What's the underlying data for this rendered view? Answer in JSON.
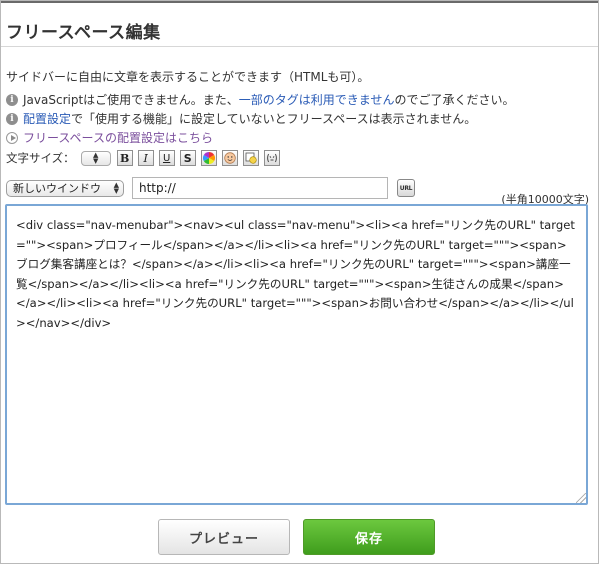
{
  "page": {
    "title": "フリースペース編集",
    "intro": "サイドバーに自由に文章を表示することができます（HTMLも可）。"
  },
  "notices": {
    "js_text_before": "JavaScriptはご使用できません。また、",
    "js_link": "一部のタグは利用できません",
    "js_text_after": "のでご了承ください。",
    "placement_link": "配置設定",
    "placement_text": "で「使用する機能」に設定していないとフリースペースは表示されません。",
    "placement_settings_link": "フリースペースの配置設定はこちら"
  },
  "toolbar": {
    "font_size_label": "文字サイズ：",
    "buttons": [
      {
        "label": "B",
        "name": "bold"
      },
      {
        "label": "I",
        "name": "italic"
      },
      {
        "label": "U",
        "name": "underline"
      },
      {
        "label": "S",
        "name": "strike"
      }
    ]
  },
  "link_row": {
    "target_option": "新しいウインドウ",
    "url_value": "http://",
    "url_button": "URL"
  },
  "editor": {
    "char_limit": "(半角10000文字)",
    "content": "<div class=\"nav-menubar\"><nav><ul class=\"nav-menu\"><li><a href=\"リンク先のURL\" target=\"\"><span>プロフィール</span></a></li><li><a href=\"リンク先のURL\" target=\"\"\"><span>ブログ集客講座とは？</span></a></li><li><a href=\"リンク先のURL\" target=\"\"\"><span>講座一覧</span></a></li><li><a href=\"リンク先のURL\" target=\"\"\"><span>生徒さんの成果</span></a></li><li><a href=\"リンク先のURL\" target=\"\"\"><span>お問い合わせ</span></a></li></ul></nav></div>"
  },
  "actions": {
    "preview": "プレビュー",
    "save": "保存"
  },
  "colors": {
    "link": "#2a5bb6",
    "visited_link": "#7b4f9d",
    "save_button": "#4ea62a",
    "editor_border": "#7aa7d6"
  }
}
